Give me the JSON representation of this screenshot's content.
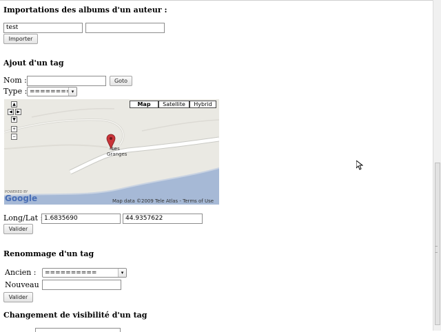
{
  "import_section": {
    "title": "Importations des albums d'un auteur :",
    "author_value": "test",
    "second_value": "",
    "import_button": "Importer"
  },
  "add_tag": {
    "title": "Ajout d'un tag",
    "name_label": "Nom :",
    "name_value": "",
    "goto_button": "Goto",
    "type_label": "Type :",
    "type_selected": "========",
    "map": {
      "type_buttons": [
        "Map",
        "Satellite",
        "Hybrid"
      ],
      "place_label_1": "Les",
      "place_label_2": "Granges",
      "powered_by": "POWERED BY",
      "logo": "Google",
      "copyright": "Map data ©2009 Tele Atlas - Terms of Use",
      "controls": [
        "pan-up",
        "pan-left",
        "pan-right",
        "pan-down",
        "zoom-in",
        "zoom-out"
      ]
    },
    "longlat_label": "Long/Lat :",
    "long_value": "1.6835690",
    "lat_value": "44.9357622",
    "validate_button": "Valider"
  },
  "rename_tag": {
    "title": "Renommage d'un tag",
    "old_label": "Ancien :",
    "old_selected": "==========",
    "new_label": "Nouveau :",
    "new_value": "",
    "validate_button": "Valider"
  },
  "visibility_tag": {
    "title": "Changement de visibilité d'un tag"
  },
  "colors": {
    "water": "#a6b9d6",
    "road": "#ffffff",
    "land": "#eae9e3",
    "marker": "#c9353a"
  }
}
